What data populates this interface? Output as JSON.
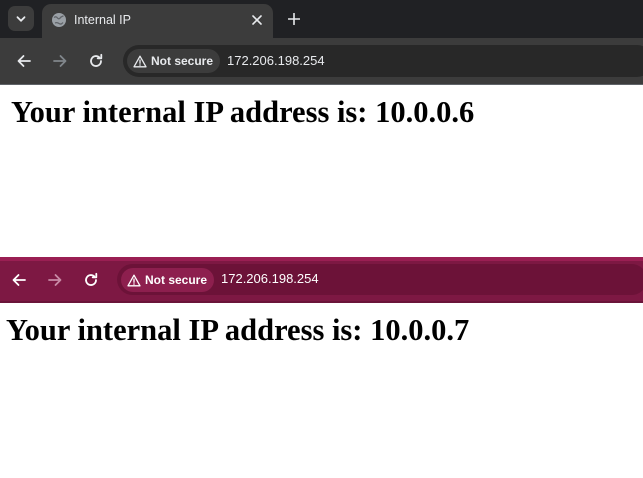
{
  "window1": {
    "tab": {
      "title": "Internal IP"
    },
    "security_chip": {
      "label": "Not secure"
    },
    "address": "172.206.198.254",
    "page": {
      "heading": "Your internal IP address is: 10.0.0.6"
    }
  },
  "window2": {
    "security_chip": {
      "label": "Not secure"
    },
    "address": "172.206.198.254",
    "page": {
      "heading": "Your internal IP address is: 10.0.0.7"
    }
  },
  "colors": {
    "dark_toolbar": "#3c3c3c",
    "dark_tabstrip": "#202124",
    "crimson_toolbar": "#7d1843",
    "text_light": "#e8eaed"
  },
  "icons": {
    "tab_search": "chevron-down-icon",
    "favicon": "globe-icon",
    "close": "close-icon",
    "new_tab": "plus-icon",
    "back": "arrow-left-icon",
    "forward": "arrow-right-icon",
    "reload": "reload-icon",
    "warning": "warning-triangle-icon"
  }
}
